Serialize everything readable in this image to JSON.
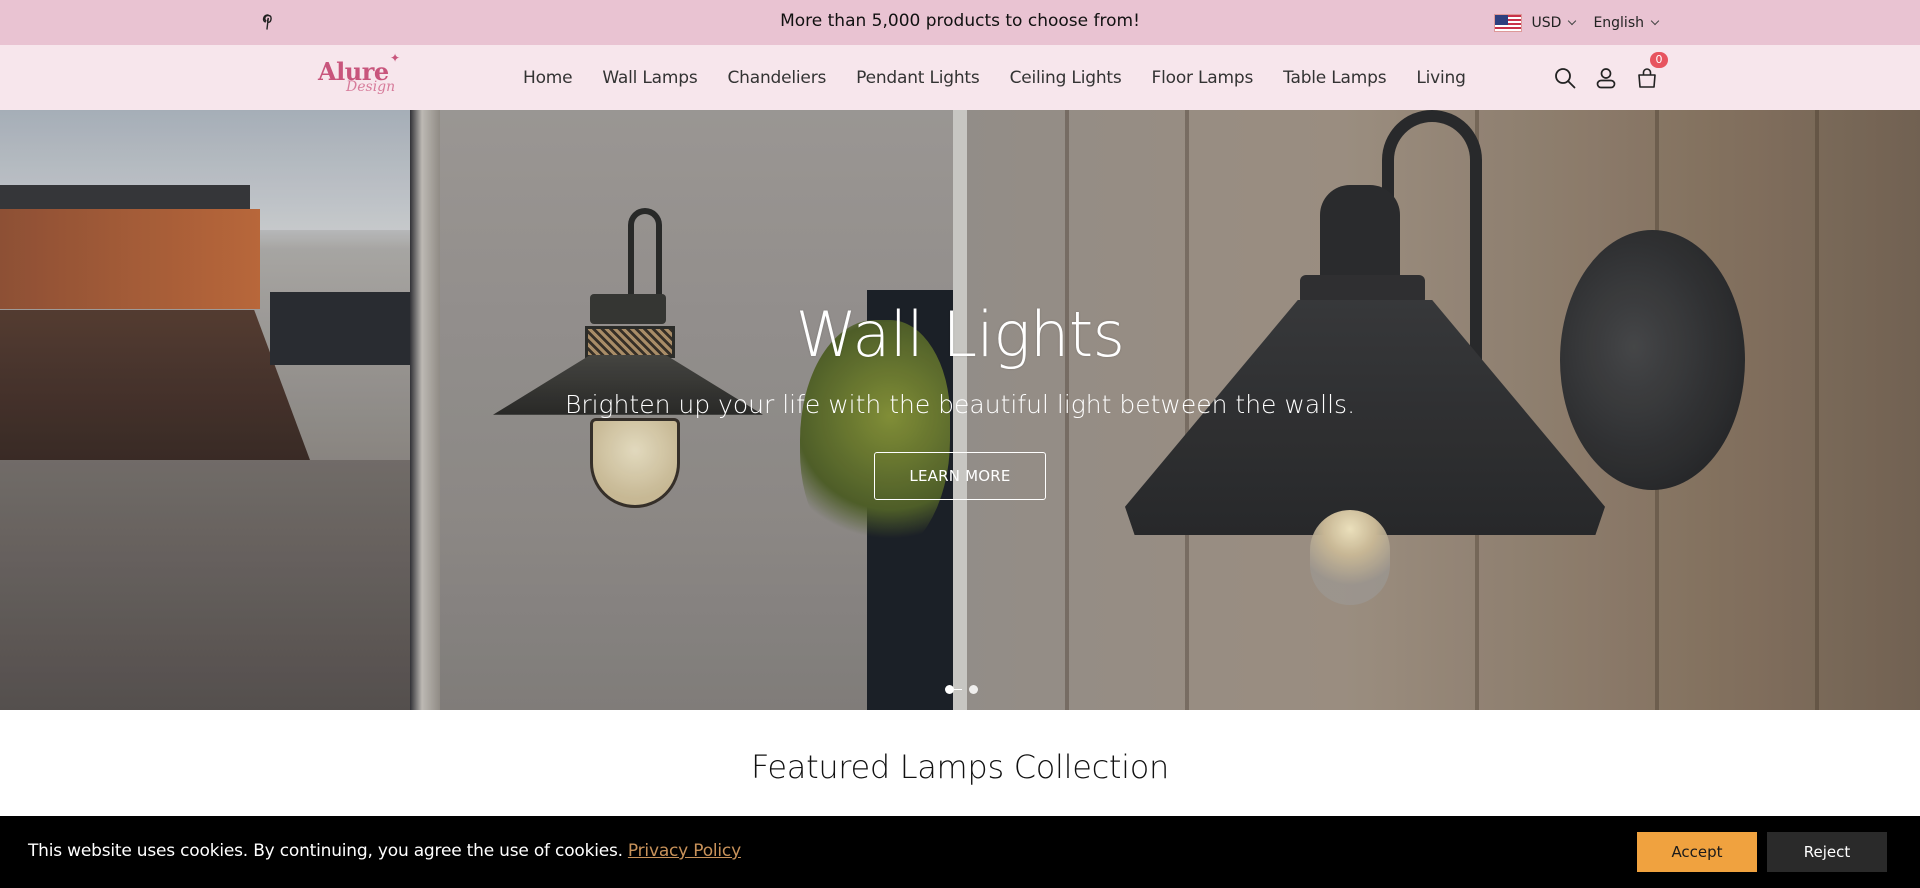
{
  "announcement": {
    "social_icon": "pinterest-icon",
    "text": "More than 5,000 products to choose from!",
    "currency": {
      "flag_icon": "us-flag-icon",
      "value": "USD"
    },
    "language": {
      "value": "English"
    }
  },
  "header": {
    "logo": {
      "line1": "Alure",
      "line2": "Design",
      "star": "✦"
    },
    "nav": [
      {
        "label": "Home"
      },
      {
        "label": "Wall Lamps"
      },
      {
        "label": "Chandeliers"
      },
      {
        "label": "Pendant Lights"
      },
      {
        "label": "Ceiling Lights"
      },
      {
        "label": "Floor Lamps"
      },
      {
        "label": "Table Lamps"
      },
      {
        "label": "Living"
      }
    ],
    "icons": [
      "search-icon",
      "account-icon",
      "cart-icon"
    ],
    "cart_count": "0"
  },
  "hero": {
    "title": "Wall Lights",
    "subtitle": "Brighten up your life with the beautiful light between the walls.",
    "button_label": "LEARN MORE",
    "slides_total": 2,
    "active_slide": 1
  },
  "featured": {
    "title": "Featured Lamps Collection"
  },
  "cookie_banner": {
    "text": "This website uses cookies. By continuing, you agree the use of cookies.",
    "link_label": "Privacy Policy",
    "accept_label": "Accept",
    "reject_label": "Reject"
  },
  "colors": {
    "announcement_bg": "#e9c3d2",
    "header_bg": "#f7e6ec",
    "brand_pink": "#c8557c",
    "badge_red": "#e7545f",
    "accept_orange": "#f0a23f",
    "reject_dark": "#2a2a2a",
    "link_gold": "#c8925a"
  }
}
